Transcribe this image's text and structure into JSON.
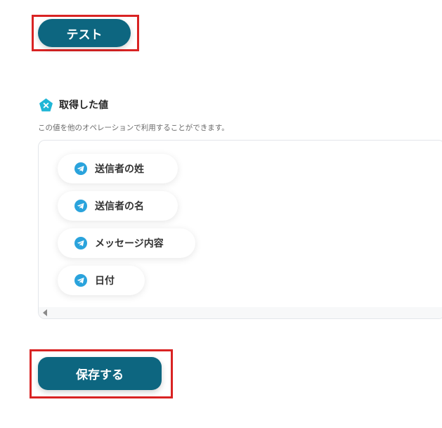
{
  "buttons": {
    "test_label": "テスト",
    "save_label": "保存する"
  },
  "section": {
    "title": "取得した値",
    "hint": "この値を他のオペレーションで利用することができます。"
  },
  "values": [
    {
      "label": "送信者の姓",
      "icon": "telegram-icon"
    },
    {
      "label": "送信者の名",
      "icon": "telegram-icon"
    },
    {
      "label": "メッセージ内容",
      "icon": "telegram-icon"
    },
    {
      "label": "日付",
      "icon": "telegram-icon"
    }
  ],
  "colors": {
    "primary_button": "#0d6680",
    "highlight": "#d92323",
    "badge": "#1fb6d6",
    "telegram": "#2aa3dc"
  }
}
